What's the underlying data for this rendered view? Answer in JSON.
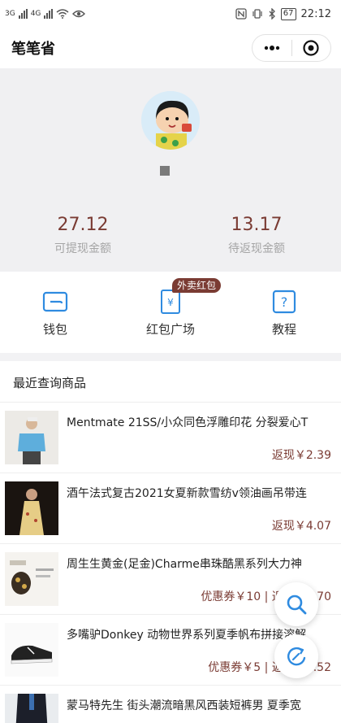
{
  "status_bar": {
    "network_left": "3G",
    "network_right": "4G",
    "battery": "67",
    "time": "22:12"
  },
  "nav": {
    "title": "笔笔省"
  },
  "account": {
    "withdrawable_value": "27.12",
    "withdrawable_label": "可提现金额",
    "pending_value": "13.17",
    "pending_label": "待返现金额"
  },
  "menu": {
    "wallet_label": "钱包",
    "redpacket_label": "红包广场",
    "redpacket_badge": "外卖红包",
    "tutorial_label": "教程",
    "wallet_icon": "wallet-icon",
    "redpacket_icon": "red-envelope-icon",
    "tutorial_icon": "question-icon"
  },
  "recent": {
    "title": "最近查询商品",
    "items": [
      {
        "title": "Mentmate 21SS/小众同色浮雕印花 分裂爱心T",
        "price": "返现￥2.39"
      },
      {
        "title": "酒午法式复古2021女夏新款雪纺v领油画吊带连",
        "price": "返现￥4.07"
      },
      {
        "title": "周生生黄金(足金)Charme串珠酷黑系列大力神",
        "price": "优惠券￥10 | 返现￥1.70"
      },
      {
        "title": "多嘴驴Donkey 动物世界系列夏季帆布拼接溶解",
        "price": "优惠券￥5 | 返现￥1.52"
      },
      {
        "title": "蒙马特先生 街头潮流暗黑风西装短裤男 夏季宽",
        "price": ""
      }
    ]
  },
  "fabs": {
    "search_icon": "search-icon",
    "share_icon": "share-icon"
  },
  "colors": {
    "accent": "#2f8be0",
    "brand": "#7a3b33",
    "hero_bg": "#f0f0f2"
  }
}
